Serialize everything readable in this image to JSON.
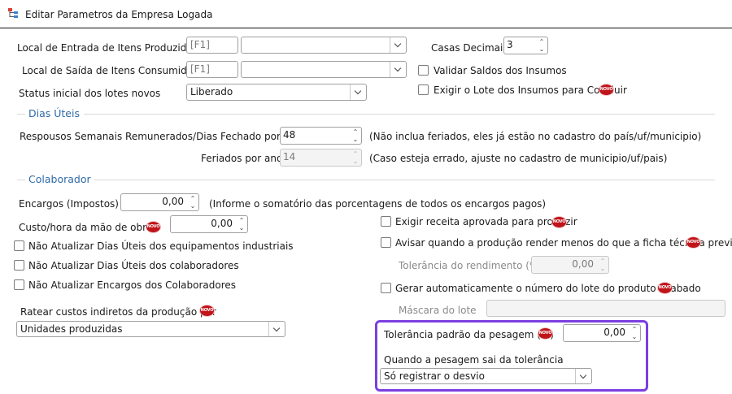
{
  "window": {
    "title": "Editar Parametros da Empresa Logada",
    "app_icon": "tree-structure-icon"
  },
  "top": {
    "local_entrada_label": "Local de Entrada de Itens Produzidos",
    "local_entrada_code": "[F1]",
    "local_entrada_value": "",
    "local_saida_label": "Local de Saída de Itens Consumidos",
    "local_saida_code": "[F1]",
    "local_saida_value": "",
    "status_label": "Status inicial dos lotes novos",
    "status_value": "Liberado",
    "casas_label": "Casas Decimais",
    "casas_value": "3",
    "validar_saldos_label": "Validar Saldos dos Insumos",
    "validar_saldos_checked": false,
    "exigir_lote_label": "Exigir o Lote dos Insumos para Concluir",
    "exigir_lote_checked": false
  },
  "novo_badge": "NOVO",
  "dias_uteis": {
    "title": "Dias Úteis",
    "repousos_label": "Respousos Semanais Remunerados/Dias Fechado por ano",
    "repousos_value": "48",
    "repousos_hint": "(Não inclua feriados, eles já estão no cadastro do país/uf/municipio)",
    "feriados_label": "Feriados por ano",
    "feriados_value": "14",
    "feriados_hint": "(Caso esteja errado, ajuste no cadastro de municipio/uf/pais)"
  },
  "colaborador": {
    "title": "Colaborador",
    "encargos_label": "Encargos (Impostos)",
    "encargos_value": "0,00",
    "encargos_hint": "(Informe o somatório das porcentagens de todos os encargos pagos)",
    "custo_hora_label": "Custo/hora da mão de obra:",
    "custo_hora_value": "0,00",
    "nao_atualizar_dias_equip_label": "Não Atualizar Dias Úteis dos equipamentos industriais",
    "nao_atualizar_dias_colab_label": "Não Atualizar Dias Úteis dos colaboradores",
    "nao_atualizar_encargos_label": "Não Atualizar Encargos dos Colaboradores",
    "ratear_label": "Ratear custos indiretos da produção por",
    "ratear_value": "Unidades produzidas",
    "exigir_receita_label": "Exigir receita aprovada para produzir",
    "avisar_producao_label": "Avisar quando a produção render menos do que a ficha técnica previa",
    "tolerancia_rend_label": "Tolerância do rendimento (%)",
    "tolerancia_rend_value": "0,00",
    "gerar_lote_label": "Gerar automaticamente o número do lote do produto acabado",
    "mascara_label": "Máscara do lote",
    "mascara_value": "",
    "tolerancia_pesagem_label": "Tolerância padrão da pesagem (%)",
    "tolerancia_pesagem_value": "0,00",
    "quando_pesagem_label": "Quando a pesagem sai da tolerância",
    "quando_pesagem_value": "Só registrar o desvio"
  },
  "colors": {
    "section": "#2f6aa8",
    "highlight": "#7b3fe0",
    "badge": "#c0141b"
  }
}
